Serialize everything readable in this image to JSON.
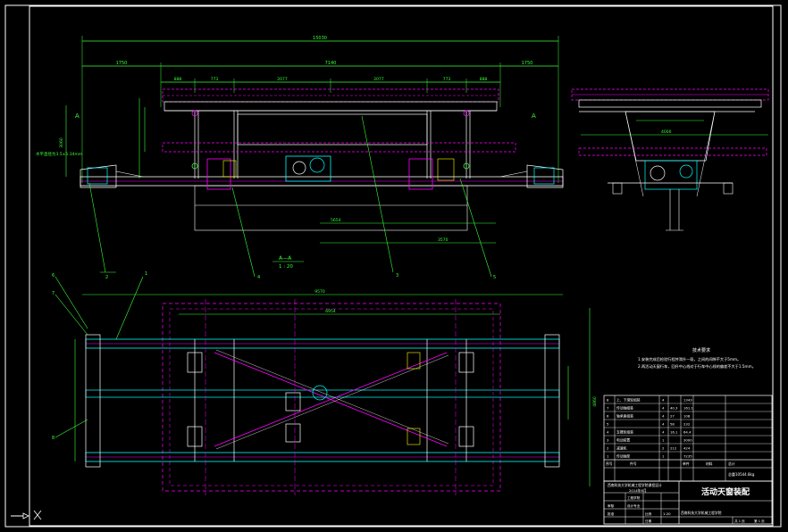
{
  "drawing": {
    "title": "活动天窗装配",
    "section_label": "A—A",
    "section_scale": "1 : 20",
    "section_marker": "A",
    "dimensions": {
      "overall_width": "15030",
      "left_overhang": "1750",
      "middle_span": "7140",
      "right_overhang": "1750",
      "seg_a": "888",
      "seg_b": "773",
      "seg_c": "2077",
      "seg_d": "2077",
      "seg_e": "773",
      "seg_f": "888",
      "inner_span": "5654",
      "offset_span": "3570",
      "plan_width": "9570",
      "plan_inner": "6954",
      "side_span": "4000",
      "left_height": "3060",
      "right_height": "4860",
      "level_note": "水平直径为3.5±5.34mm"
    },
    "callouts": [
      "1",
      "2",
      "3",
      "4",
      "5",
      "6",
      "7",
      "8"
    ],
    "notes": {
      "heading": "技术要求",
      "line1": "1.安装完成后检验行程并滑升一段，之间的间隙不大于5mm。",
      "line2": "2.两活动天窗行车，回升中心线对于行车中心线的偏差不大于1.5mm。"
    },
    "bom": [
      {
        "no": "8",
        "name": "上、下滑轮组装",
        "qty": "4",
        "w1": "",
        "w2": "1343"
      },
      {
        "no": "7",
        "name": "传动轴组装",
        "qty": "4",
        "w1": "40.3",
        "w2": "161.1"
      },
      {
        "no": "6",
        "name": "轴承座组装",
        "qty": "4",
        "w1": "27",
        "w2": "108"
      },
      {
        "no": "5",
        "name": "",
        "qty": "4",
        "w1": "58",
        "w2": "232"
      },
      {
        "no": "4",
        "name": "支撑轮组装",
        "qty": "4",
        "w1": "16.1",
        "w2": "64.4"
      },
      {
        "no": "3",
        "name": "电动装置",
        "qty": "1",
        "w1": "",
        "w2": "3000"
      },
      {
        "no": "2",
        "name": "减速机",
        "qty": "2",
        "w1": "212",
        "w2": "424"
      },
      {
        "no": "1",
        "name": "传动轴架",
        "qty": "1",
        "w1": "",
        "w2": "7235"
      }
    ],
    "bom_header": {
      "h1": "序号",
      "h2": "件号",
      "h3": "材料",
      "h4": "单件",
      "h5": "总计"
    },
    "bom_footer": "总重10544.8kg",
    "titleblock": {
      "school": "西南科技大学机械工程学院课程设计",
      "year": "2014年6月",
      "r1": "工程学院",
      "r2": "设计专业",
      "r3": "比例",
      "scale": "1:20",
      "r4": "审核",
      "r5": "批准",
      "r6": "日期",
      "desc": "西南科技大学机械工程学院",
      "sheet": "共 1 页",
      "page": "第 1 页"
    },
    "colors": {
      "background": "#000000",
      "frame": "#ffffff",
      "dimension": "#39ff39",
      "hidden": "#ff00ff",
      "centerline": "#ff3030",
      "part": "#00ffff",
      "yellow": "#ffff00"
    }
  }
}
